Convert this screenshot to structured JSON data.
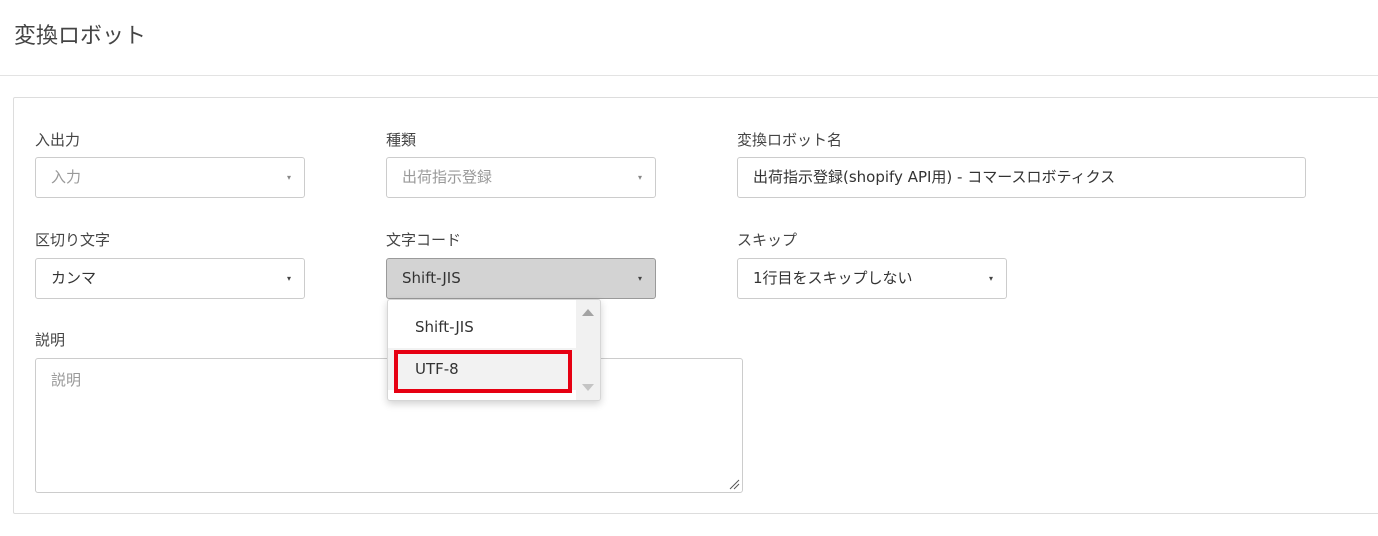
{
  "page": {
    "title": "変換ロボット"
  },
  "form": {
    "io": {
      "label": "入出力",
      "value": "入力"
    },
    "type": {
      "label": "種類",
      "value": "出荷指示登録"
    },
    "robot_name": {
      "label": "変換ロボット名",
      "value": "出荷指示登録(shopify API用) - コマースロボティクス"
    },
    "delimiter": {
      "label": "区切り文字",
      "value": "カンマ"
    },
    "encoding": {
      "label": "文字コード",
      "value": "Shift-JIS",
      "options": [
        "Shift-JIS",
        "UTF-8"
      ]
    },
    "skip": {
      "label": "スキップ",
      "value": "1行目をスキップしない"
    },
    "description": {
      "label": "説明",
      "placeholder": "説明"
    }
  },
  "icons": {
    "caret": "▾",
    "caret_icon": "caret-down-icon",
    "scroll_up_icon": "scroll-up-icon",
    "scroll_down_icon": "scroll-down-icon",
    "resize_icon": "resize-handle-icon"
  },
  "colors": {
    "highlight": "#e60012",
    "active_select": "#d3d3d3"
  }
}
